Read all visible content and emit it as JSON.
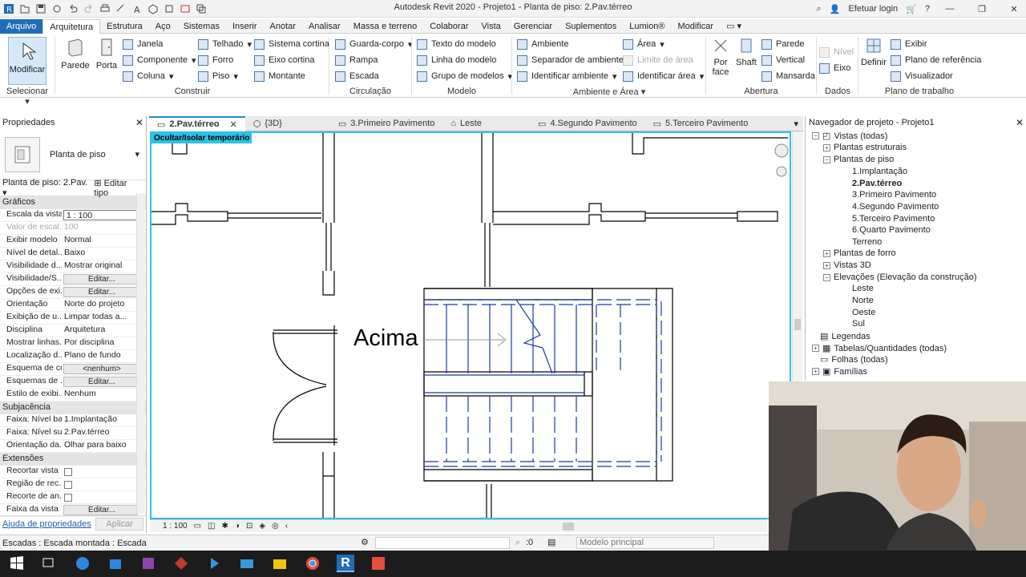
{
  "titlebar": {
    "title": "Autodesk Revit 2020 - Projeto1 - Planta de piso: 2.Pav.térreo",
    "login": "Efetuar login",
    "help": "?"
  },
  "ribbon_tabs": [
    "Arquivo",
    "Arquitetura",
    "Estrutura",
    "Aço",
    "Sistemas",
    "Inserir",
    "Anotar",
    "Analisar",
    "Massa e terreno",
    "Colaborar",
    "Vista",
    "Gerenciar",
    "Suplementos",
    "Lumion®",
    "Modificar"
  ],
  "ribbon": {
    "modificar": "Modificar",
    "parede": "Parede",
    "porta": "Porta",
    "janela": "Janela",
    "componente": "Componente",
    "coluna": "Coluna",
    "telhado": "Telhado",
    "forro": "Forro",
    "piso": "Piso",
    "sistema_cortina": "Sistema cortina",
    "eixo_cortina": "Eixo cortina",
    "montante": "Montante",
    "guarda_corpo": "Guarda-corpo",
    "rampa": "Rampa",
    "escada": "Escada",
    "texto_modelo": "Texto do modelo",
    "linha_modelo": "Linha do modelo",
    "grupo_modelos": "Grupo de modelos",
    "ambiente": "Ambiente",
    "separador": "Separador de ambiente",
    "identificar_ambiente": "Identificar ambiente",
    "area": "Área",
    "limite_area": "Limite de área",
    "identificar_area": "Identificar área",
    "por_face": "Por face",
    "shaft": "Shaft",
    "parede_ab": "Parede",
    "vertical": "Vertical",
    "mansarda": "Mansarda",
    "nivel": "Nível",
    "eixo": "Eixo",
    "definir": "Definir",
    "exibir": "Exibir",
    "plano_referencia": "Plano de referência",
    "visualizador": "Visualizador",
    "panels": {
      "selecionar": "Selecionar",
      "construir": "Construir",
      "circulacao": "Circulação",
      "modelo": "Modelo",
      "ambiente_area": "Ambiente e Área",
      "abertura": "Abertura",
      "dados": "Dados",
      "plano_trabalho": "Plano de trabalho"
    }
  },
  "properties": {
    "header": "Propriedades",
    "type_name": "Planta de piso",
    "instance_select": "Planta de piso: 2.Pav.",
    "edit_type": "Editar tipo",
    "sections": {
      "graficos": "Gráficos",
      "subjacencia": "Subjacência",
      "extensoes": "Extensões"
    },
    "graficos_rows": [
      {
        "k": "Escala da vista",
        "v": "1 : 100"
      },
      {
        "k": "Valor de escal...",
        "v": "100"
      },
      {
        "k": "Exibir modelo",
        "v": "Normal"
      },
      {
        "k": "Nível de detal...",
        "v": "Baixo"
      },
      {
        "k": "Visibilidade d...",
        "v": "Mostrar original"
      },
      {
        "k": "Visibilidade/S...",
        "v": "Editar..."
      },
      {
        "k": "Opções de exi...",
        "v": "Editar..."
      },
      {
        "k": "Orientação",
        "v": "Norte do projeto"
      },
      {
        "k": "Exibição de u...",
        "v": "Limpar todas a..."
      },
      {
        "k": "Disciplina",
        "v": "Arquitetura"
      },
      {
        "k": "Mostrar linhas...",
        "v": "Por disciplina"
      },
      {
        "k": "Localização d...",
        "v": "Plano de fundo"
      },
      {
        "k": "Esquema de cor",
        "v": "<nenhum>"
      },
      {
        "k": "Esquemas de ...",
        "v": "Editar..."
      },
      {
        "k": "Estilo de exibi...",
        "v": "Nenhum"
      }
    ],
    "subjacencia_rows": [
      {
        "k": "Faixa: Nível ba...",
        "v": "1.Implantação"
      },
      {
        "k": "Faixa: Nível su...",
        "v": "2.Pav.térreo"
      },
      {
        "k": "Orientação da...",
        "v": "Olhar para baixo"
      }
    ],
    "extensoes_rows": [
      {
        "k": "Recortar vista",
        "v": ""
      },
      {
        "k": "Região de rec...",
        "v": ""
      },
      {
        "k": "Recorte de an...",
        "v": ""
      },
      {
        "k": "Faixa da vista",
        "v": "Editar..."
      }
    ],
    "help_link": "Ajuda de propriedades",
    "apply": "Aplicar"
  },
  "view_tabs": [
    "2.Pav.térreo",
    "{3D}",
    "3.Primeiro Pavimento",
    "Leste",
    "4.Segundo Pavimento",
    "5.Terceiro Pavimento"
  ],
  "canvas": {
    "isolate_label": "Ocultar/Isolar temporário",
    "stair_text": "Acima"
  },
  "viewbar": {
    "scale": "1 : 100"
  },
  "browser": {
    "header": "Navegador de projeto - Projeto1",
    "root": "Vistas (todas)",
    "plantas_estruturais": "Plantas estruturais",
    "plantas_piso": "Plantas de piso",
    "pisos": [
      "1.Implantação",
      "2.Pav.térreo",
      "3.Primeiro Pavimento",
      "4.Segundo Pavimento",
      "5.Terceiro Pavimento",
      "6.Quarto Pavimento",
      "Terreno"
    ],
    "plantas_forro": "Plantas de forro",
    "vistas_3d": "Vistas 3D",
    "elevacoes": "Elevações (Elevação da construção)",
    "elevacoes_items": [
      "Leste",
      "Norte",
      "Oeste",
      "Sul"
    ],
    "legendas": "Legendas",
    "tabelas": "Tabelas/Quantidades (todas)",
    "folhas": "Folhas (todas)",
    "familias": "Famílias"
  },
  "status": {
    "text": "Escadas : Escada montada : Escada",
    "coord": ":0",
    "model": "Modelo principal"
  },
  "colors": {
    "accent": "#2bc3e8",
    "app_blue": "#1f6db8",
    "stair_blue": "#1a3b9e"
  }
}
